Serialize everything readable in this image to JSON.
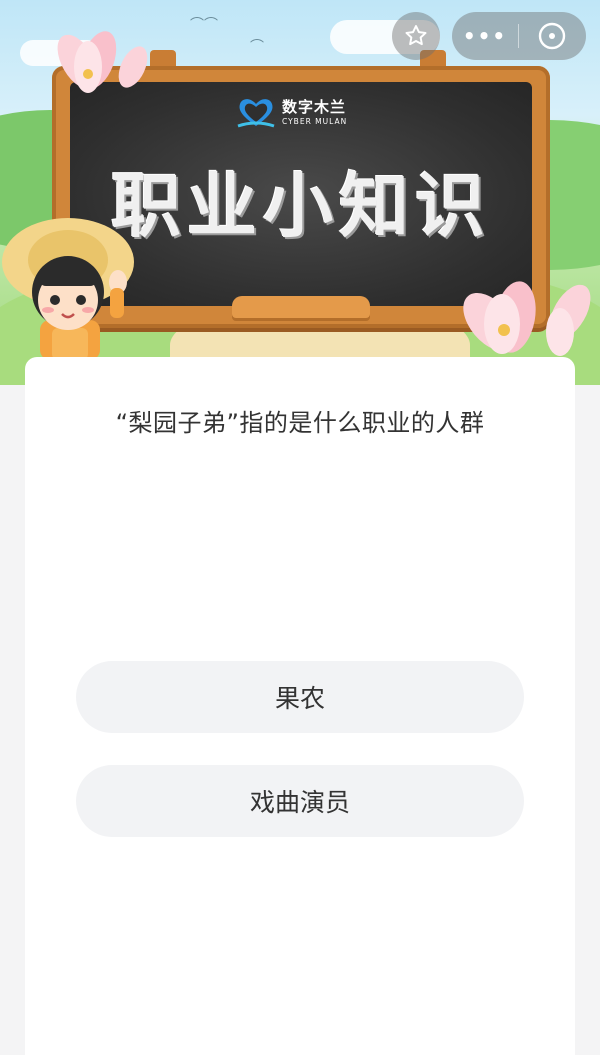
{
  "banner": {
    "logo_cn": "数字木兰",
    "logo_en": "CYBER MULAN",
    "board_title": "职业小知识"
  },
  "nav": {
    "star_icon": "star-outline-icon",
    "more_icon": "more-dots-icon",
    "more_label": "•••",
    "close_icon": "close-circle-icon"
  },
  "quiz": {
    "question": "“梨园子弟”指的是什么职业的人群",
    "options": [
      {
        "label": "果农"
      },
      {
        "label": "戏曲演员"
      }
    ]
  },
  "colors": {
    "option_bg": "#f2f3f5",
    "text": "#333333",
    "board": "#2f2f2f",
    "frame": "#d0863a"
  }
}
